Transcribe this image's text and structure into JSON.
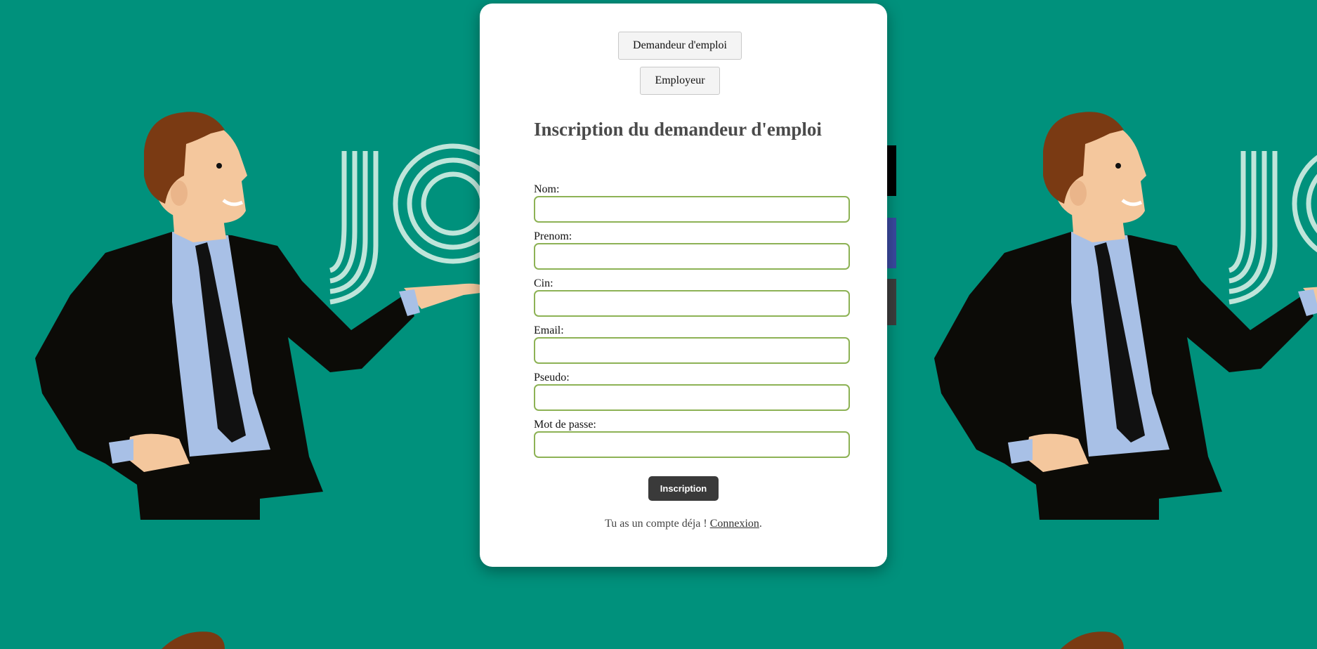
{
  "colors": {
    "background": "#00917c",
    "card": "#ffffff",
    "input_border": "#8db255",
    "submit_button": "#3a3a3a",
    "title_text": "#4a4a4a"
  },
  "background_art": {
    "logo_text": "JO",
    "figure": "businessman-presenting"
  },
  "role_switch": {
    "job_seeker_label": "Demandeur d'emploi",
    "employer_label": "Employeur"
  },
  "form": {
    "title": "Inscription du demandeur d'emploi",
    "fields": [
      {
        "label": "Nom:",
        "value": ""
      },
      {
        "label": "Prenom:",
        "value": ""
      },
      {
        "label": "Cin:",
        "value": ""
      },
      {
        "label": "Email:",
        "value": ""
      },
      {
        "label": "Pseudo:",
        "value": ""
      },
      {
        "label": "Mot de passe:",
        "value": ""
      }
    ],
    "submit_label": "Inscription"
  },
  "footer": {
    "text": "Tu as un compte déja ! ",
    "link_label": "Connexion",
    "trailing": "."
  }
}
